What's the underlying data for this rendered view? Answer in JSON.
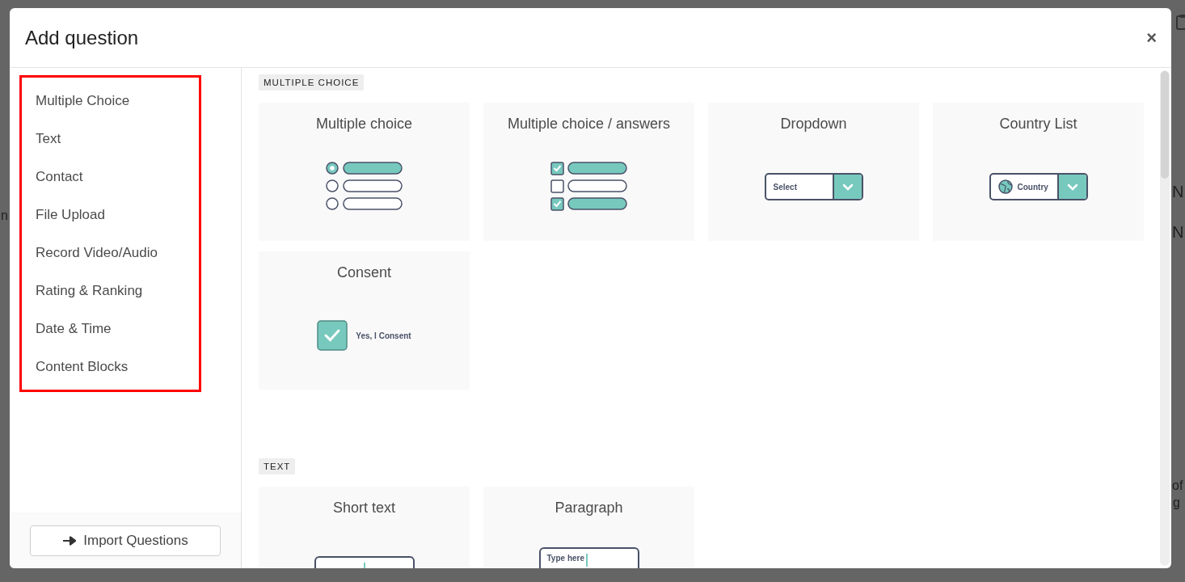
{
  "backdrop": {
    "fragments": [
      "n",
      "N",
      "N",
      "of",
      "g"
    ]
  },
  "dialog": {
    "title": "Add question",
    "close": "×"
  },
  "sidebar": {
    "outlined": true,
    "items": [
      {
        "label": "Multiple Choice"
      },
      {
        "label": "Text"
      },
      {
        "label": "Contact"
      },
      {
        "label": "File Upload"
      },
      {
        "label": "Record Video/Audio"
      },
      {
        "label": "Rating & Ranking"
      },
      {
        "label": "Date & Time"
      },
      {
        "label": "Content Blocks"
      }
    ],
    "import_button": {
      "label": "Import Questions"
    }
  },
  "sections": [
    {
      "label": "MULTIPLE CHOICE",
      "cards": [
        {
          "title": "Multiple choice",
          "kind": "radio",
          "options": [
            {
              "selected": true
            },
            {
              "selected": false
            },
            {
              "selected": false
            }
          ]
        },
        {
          "title": "Multiple choice / answers",
          "kind": "checkbox",
          "options": [
            {
              "checked": true
            },
            {
              "checked": false
            },
            {
              "checked": true
            }
          ]
        },
        {
          "title": "Dropdown",
          "kind": "dropdown",
          "text": "Select"
        },
        {
          "title": "Country List",
          "kind": "country",
          "text": "Country"
        },
        {
          "title": "Consent",
          "kind": "consent",
          "text": "Yes, I Consent"
        }
      ]
    },
    {
      "label": "TEXT",
      "cards": [
        {
          "title": "Short text",
          "kind": "short-text"
        },
        {
          "title": "Paragraph",
          "kind": "paragraph",
          "text": "Type here"
        }
      ]
    }
  ]
}
